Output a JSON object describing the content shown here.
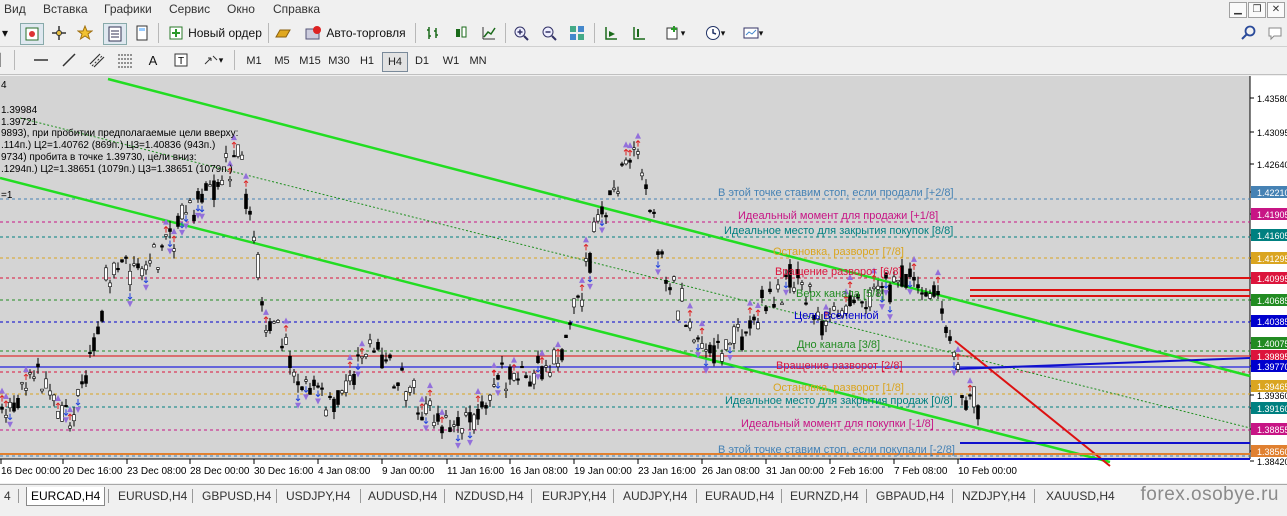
{
  "menu": [
    "Вид",
    "Вставка",
    "Графики",
    "Сервис",
    "Окно",
    "Справка"
  ],
  "toolbar": {
    "new_order": "Новый ордер",
    "autotrading": "Авто-торговля",
    "timeframes": [
      "M1",
      "M5",
      "M15",
      "M30",
      "H1",
      "H4",
      "D1",
      "W1",
      "MN"
    ],
    "active_timeframe": "H4"
  },
  "chart": {
    "symbol_fragment": "4",
    "info_lines": [
      "1.39984",
      "1.39721",
      "9893), при пробитии предполагаемые цели вверху:",
      ".114п.) Ц2=1.40762 (869п.) Ц3=1.40836 (943п.)",
      "9734) пробита в точке 1.39730, цели вниз:",
      ".1294п.) Ц2=1.38651 (1079п.) Ц3=1.38651 (1079п.)",
      "=1"
    ],
    "level_labels": [
      "В этой точке ставим стоп, если продали [+2/8]",
      "Идеальный момент для продажи [+1/8]",
      "Идеальное место для закрытия покупок [8/8]",
      "Остановка, разворот [7/8]",
      "Вращение разворот [6/8]",
      "Верх канала [5/8]",
      "Цель Вселенной",
      "Дно канала [3/8]",
      "Вращение разворот [2/8]",
      "Остановка, разворот [1/8]",
      "Идеальное место для закрытия продаж [0/8]",
      "Идеальный момент для покупки [-1/8]",
      "В этой точке ставим стоп, если покупали [-2/8]"
    ],
    "level_colors": [
      "#4682b4",
      "#c71585",
      "#008080",
      "#daa520",
      "#dc143c",
      "#228b22",
      "#0000cd",
      "#228b22",
      "#dc143c",
      "#daa520",
      "#008080",
      "#c71585",
      "#4682b4"
    ],
    "price_axis": [
      "1.43580",
      "1.43095",
      "1.42640",
      "1.42210",
      "1.41905",
      "1.41605",
      "1.41295",
      "1.40995",
      "1.40685",
      "1.40385",
      "1.40075",
      "1.39895",
      "1.39770",
      "1.39465",
      "1.39360",
      "1.39160",
      "1.38855",
      "1.38560",
      "1.38420"
    ],
    "time_axis": [
      "16 Dec 00:00",
      "20 Dec 16:00",
      "23 Dec 08:00",
      "28 Dec 00:00",
      "30 Dec 16:00",
      "4 Jan 08:00",
      "9 Jan 00:00",
      "11 Jan 16:00",
      "16 Jan 08:00",
      "19 Jan 00:00",
      "23 Jan 16:00",
      "26 Jan 08:00",
      "31 Jan 00:00",
      "2 Feb 16:00",
      "7 Feb 08:00",
      "10 Feb 00:00"
    ]
  },
  "tabs": [
    "EURCAD,H4",
    "EURUSD,H4",
    "GBPUSD,H4",
    "USDJPY,H4",
    "AUDUSD,H4",
    "NZDUSD,H4",
    "EURJPY,H4",
    "AUDJPY,H4",
    "EURAUD,H4",
    "EURNZD,H4",
    "GBPAUD,H4",
    "NZDJPY,H4",
    "XAUUSD,H4"
  ],
  "tab_first_fragment": "4",
  "watermark": "forex.osobye.ru"
}
